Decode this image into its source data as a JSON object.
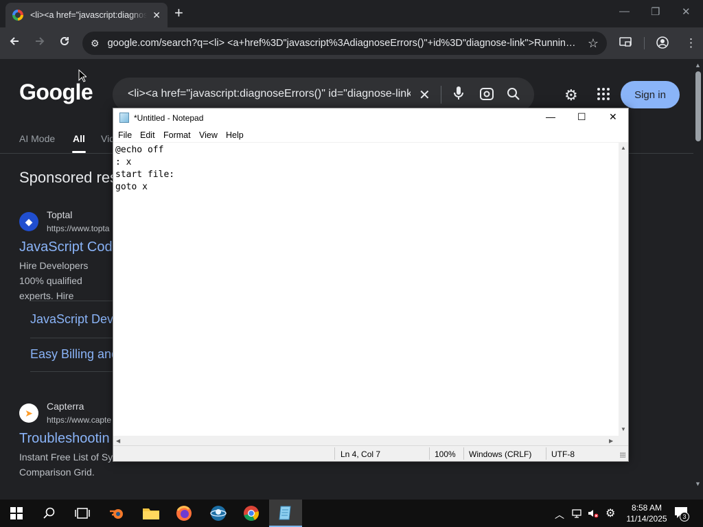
{
  "browser": {
    "tab_title": "<li><a href=\"javascript:diagnos",
    "url": "google.com/search?q=<li> <a+href%3D\"javascript%3AdiagnoseErrors()\"+id%3D\"diagnose-link\">Running+..."
  },
  "google": {
    "logo": "Google",
    "search_query": "<li><a href=\"javascript:diagnoseErrors()\" id=\"diagnose-link",
    "sign_in": "Sign in",
    "nav": [
      "AI Mode",
      "All",
      "Vid"
    ],
    "sponsored_heading": "Sponsored res",
    "ads": [
      {
        "name": "Toptal",
        "url": "https://www.topta",
        "title": "JavaScript Cod",
        "desc": "Hire Developers 100% qualified experts. Hire",
        "sitelinks": [
          "JavaScript Dev",
          "Easy Billing and"
        ]
      },
      {
        "name": "Capterra",
        "url": "https://www.capte",
        "title": "Troubleshootin",
        "desc": "Instant Free List of Sy Comparison Grid."
      }
    ]
  },
  "notepad": {
    "title": "*Untitled - Notepad",
    "menu": [
      "File",
      "Edit",
      "Format",
      "View",
      "Help"
    ],
    "content": "@echo off\n: x\nstart file:\ngoto x",
    "status": {
      "position": "Ln 4, Col 7",
      "zoom": "100%",
      "line_ending": "Windows (CRLF)",
      "encoding": "UTF-8"
    }
  },
  "taskbar": {
    "time": "8:58 AM",
    "date": "11/14/2025",
    "notification_count": "3"
  },
  "icons": {
    "chrome_back": "arrow-left",
    "chrome_forward": "arrow-right",
    "chrome_reload": "reload",
    "windows_start": "windows-logo"
  },
  "colors": {
    "chrome_dark": "#202124",
    "google_link": "#8ab4f8",
    "sign_in_bg": "#8ab4f8"
  }
}
